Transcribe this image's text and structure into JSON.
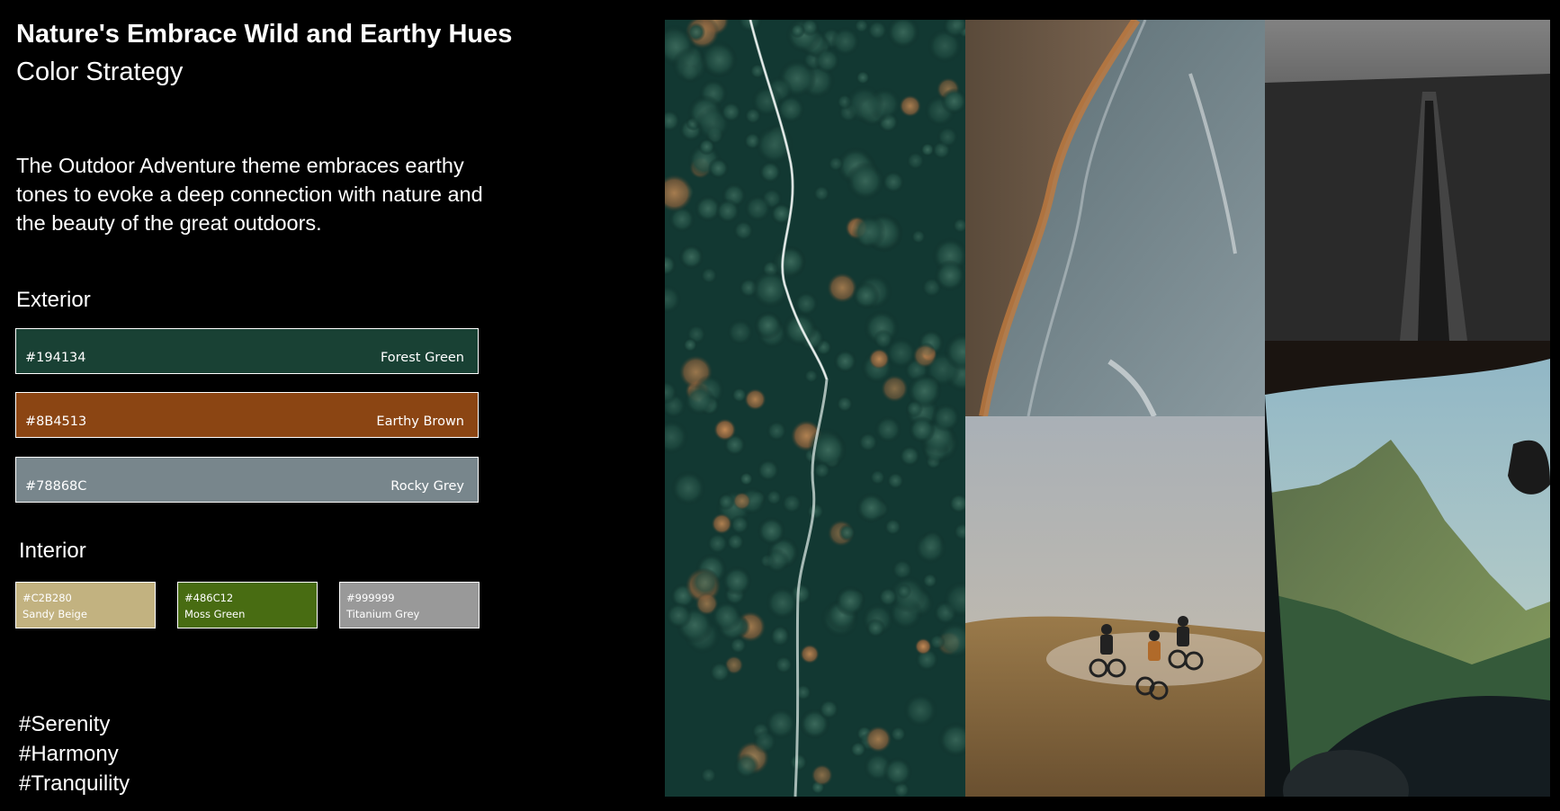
{
  "header": {
    "title": "Nature's Embrace Wild and Earthy Hues",
    "subtitle": "Color Strategy"
  },
  "description": "The Outdoor Adventure theme embraces earthy tones to evoke a deep connection with nature and the beauty of the great outdoors.",
  "exterior": {
    "label": "Exterior",
    "swatches": [
      {
        "code": "#194134",
        "name": "Forest Green",
        "color": "#194134"
      },
      {
        "code": "#8B4513",
        "name": "Earthy Brown",
        "color": "#8B4513"
      },
      {
        "code": "#78868C",
        "name": "Rocky Grey",
        "color": "#78868C"
      }
    ]
  },
  "interior": {
    "label": "Interior",
    "swatches": [
      {
        "code": "#C2B280",
        "name": "Sandy Beige",
        "color": "#C2B280"
      },
      {
        "code": "#486C12",
        "name": "Moss Green",
        "color": "#486C12"
      },
      {
        "code": "#999999",
        "name": "Titanium Grey",
        "color": "#999999"
      }
    ]
  },
  "hashtags": [
    "#Serenity",
    "#Harmony",
    "#Tranquility"
  ]
}
